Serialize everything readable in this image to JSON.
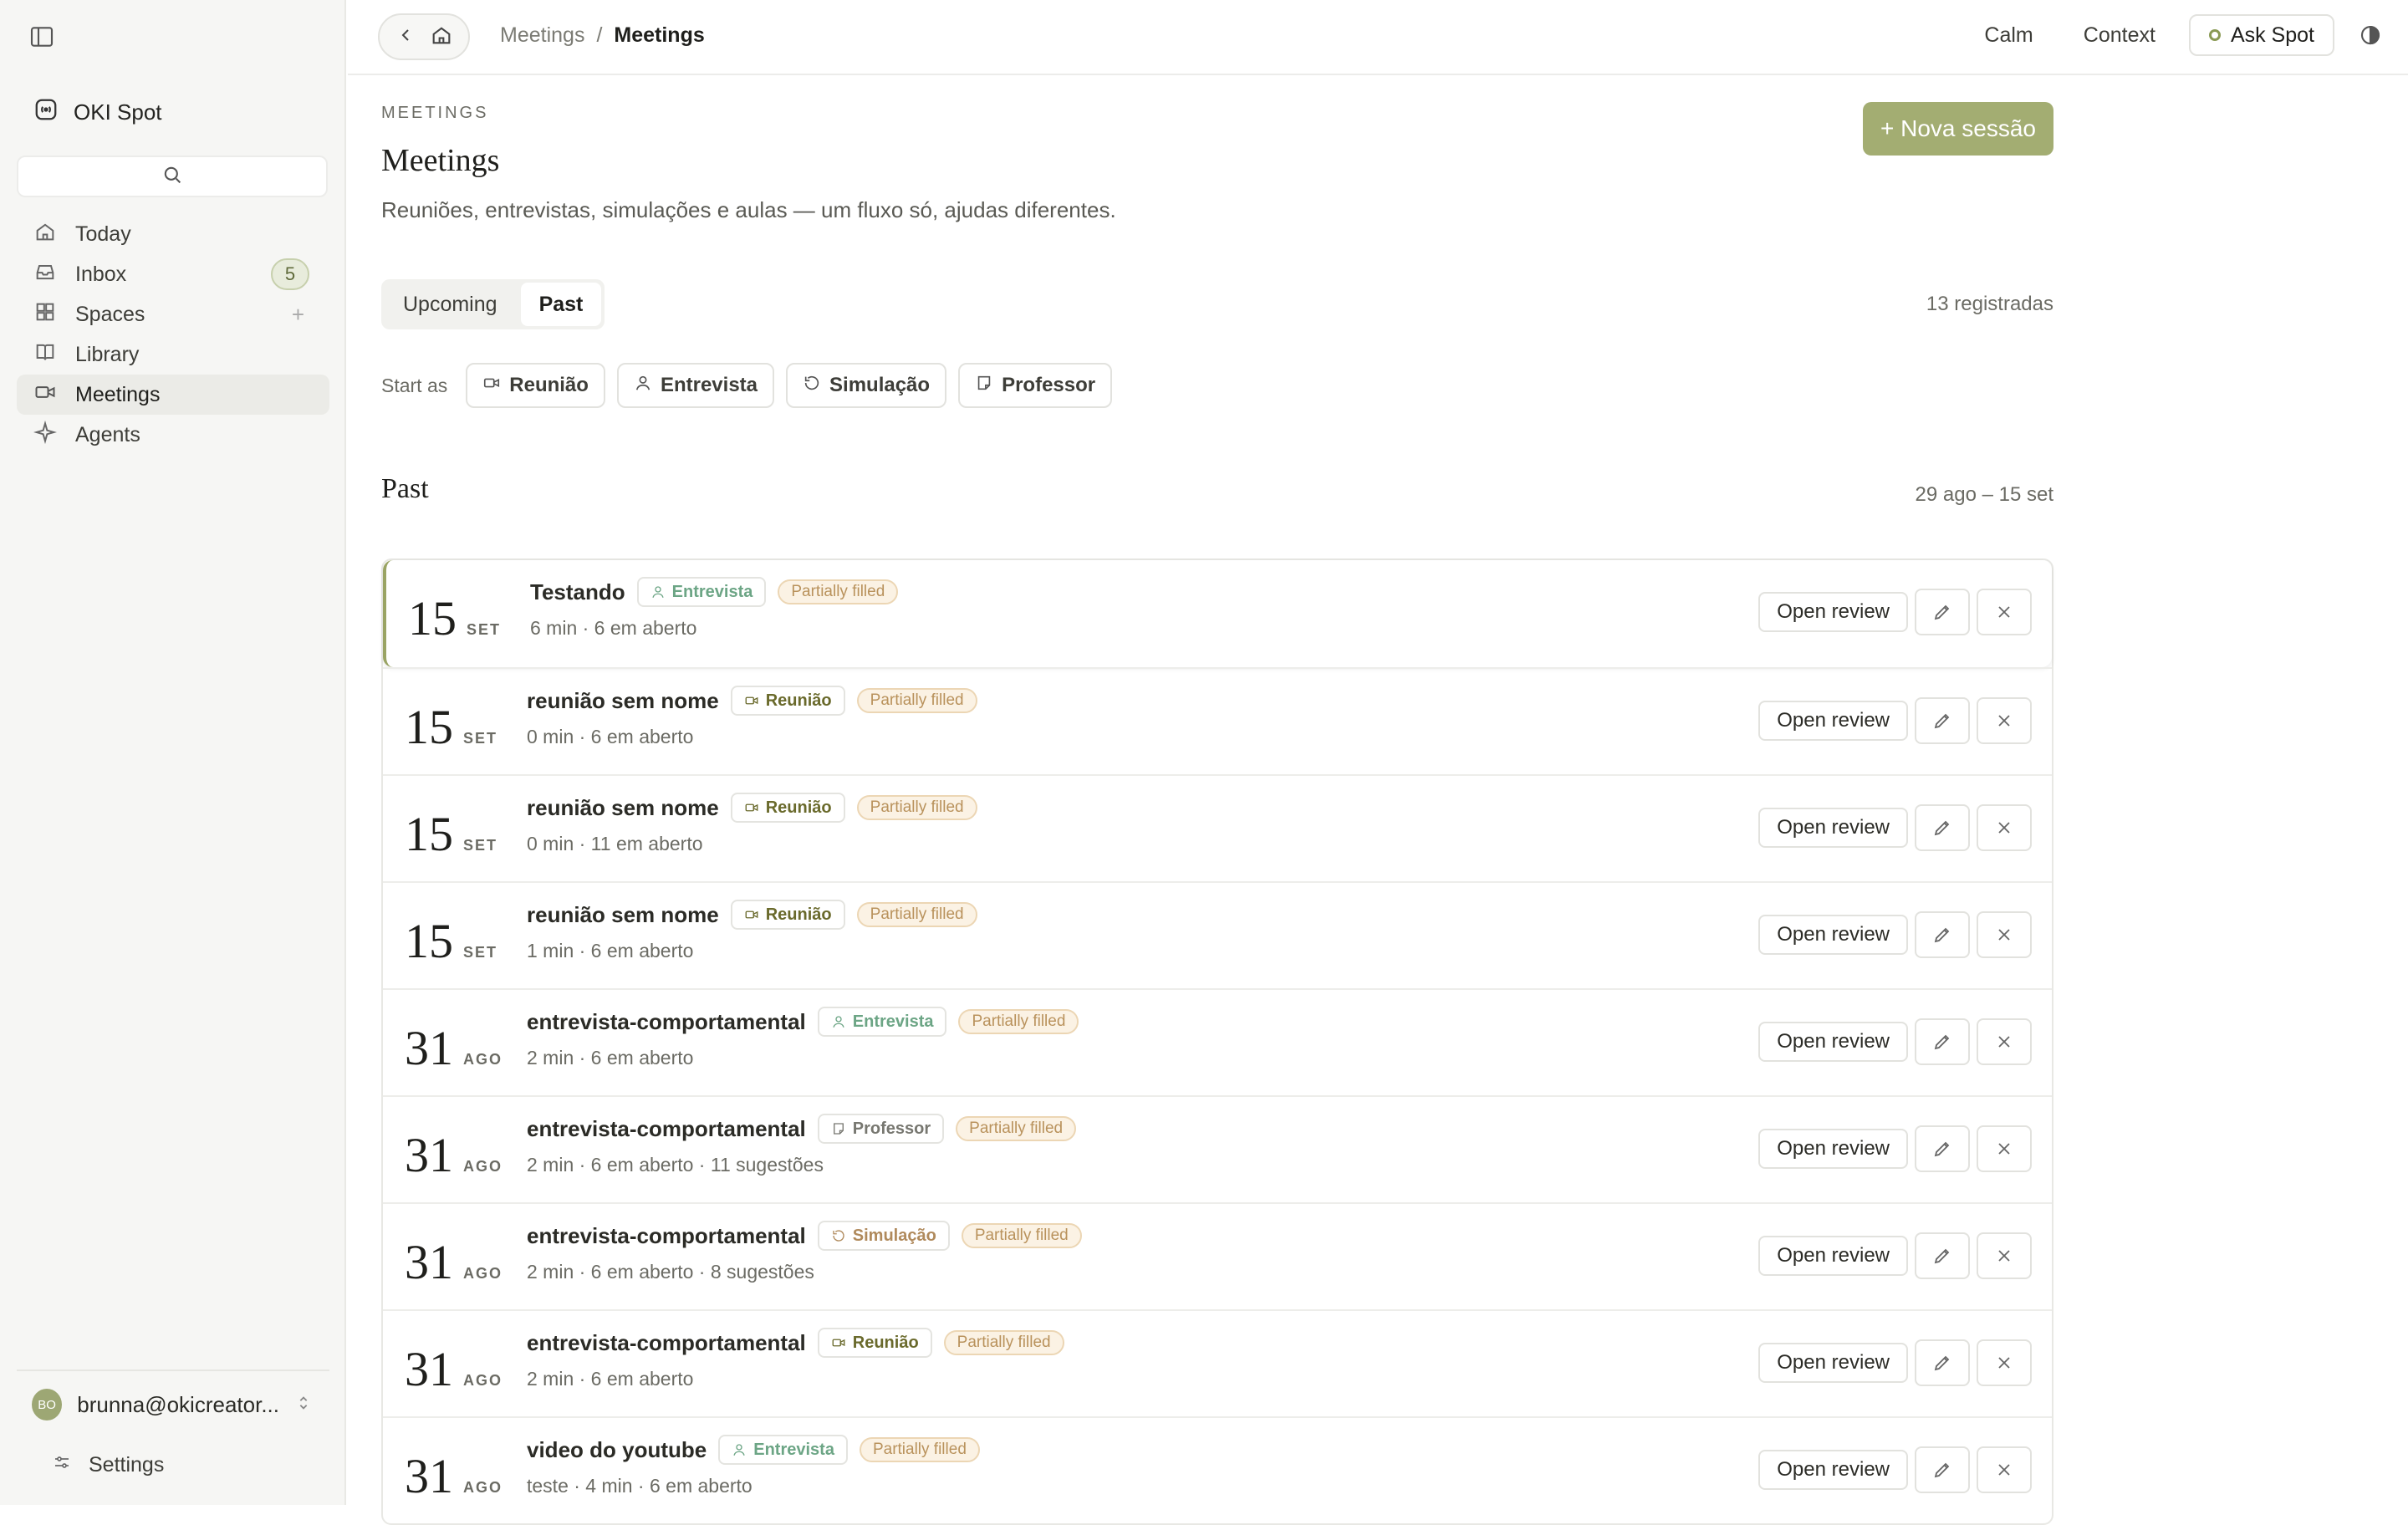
{
  "app": {
    "name": "OKI Spot"
  },
  "sidebar": {
    "items": [
      {
        "label": "Today",
        "icon": "home-icon"
      },
      {
        "label": "Inbox",
        "icon": "inbox-icon",
        "badge": "5"
      },
      {
        "label": "Spaces",
        "icon": "grid-icon"
      },
      {
        "label": "Library",
        "icon": "book-icon"
      },
      {
        "label": "Meetings",
        "icon": "video-icon",
        "active": true
      },
      {
        "label": "Agents",
        "icon": "sparkle-icon"
      }
    ],
    "user": {
      "initials": "BO",
      "email": "brunna@okicreator..."
    },
    "settings_label": "Settings"
  },
  "topbar": {
    "breadcrumb": [
      "Meetings",
      "/",
      "Meetings"
    ],
    "calm": "Calm",
    "context": "Context",
    "ask_spot": "Ask Spot"
  },
  "page": {
    "eyebrow": "MEETINGS",
    "title": "Meetings",
    "subtitle": "Reuniões, entrevistas, simulações e aulas — um fluxo só, ajudas diferentes.",
    "new_session": "+ Nova sessão",
    "tabs": [
      {
        "label": "Upcoming"
      },
      {
        "label": "Past",
        "active": true
      }
    ],
    "count": "13 registradas",
    "start_as": "Start as",
    "start_options": [
      "Reunião",
      "Entrevista",
      "Simulação",
      "Professor"
    ],
    "section_title": "Past",
    "range": "29 ago – 15 set",
    "open_review": "Open review"
  },
  "meetings": [
    {
      "day": "15",
      "month": "SET",
      "title": "Testando",
      "type": "Entrevista",
      "status": "Partially filled",
      "meta": "6 min · 6 em aberto"
    },
    {
      "day": "15",
      "month": "SET",
      "title": "reunião sem nome",
      "type": "Reunião",
      "status": "Partially filled",
      "meta": "0 min · 6 em aberto"
    },
    {
      "day": "15",
      "month": "SET",
      "title": "reunião sem nome",
      "type": "Reunião",
      "status": "Partially filled",
      "meta": "0 min · 11 em aberto"
    },
    {
      "day": "15",
      "month": "SET",
      "title": "reunião sem nome",
      "type": "Reunião",
      "status": "Partially filled",
      "meta": "1 min · 6 em aberto"
    },
    {
      "day": "31",
      "month": "AGO",
      "title": "entrevista-comportamental",
      "type": "Entrevista",
      "status": "Partially filled",
      "meta": "2 min · 6 em aberto"
    },
    {
      "day": "31",
      "month": "AGO",
      "title": "entrevista-comportamental",
      "type": "Professor",
      "status": "Partially filled",
      "meta": "2 min · 6 em aberto · 11 sugestões"
    },
    {
      "day": "31",
      "month": "AGO",
      "title": "entrevista-comportamental",
      "type": "Simulação",
      "status": "Partially filled",
      "meta": "2 min · 6 em aberto · 8 sugestões"
    },
    {
      "day": "31",
      "month": "AGO",
      "title": "entrevista-comportamental",
      "type": "Reunião",
      "status": "Partially filled",
      "meta": "2 min · 6 em aberto"
    },
    {
      "day": "31",
      "month": "AGO",
      "title": "video do youtube",
      "type": "Entrevista",
      "status": "Partially filled",
      "meta": "teste · 4 min · 6 em aberto"
    }
  ]
}
